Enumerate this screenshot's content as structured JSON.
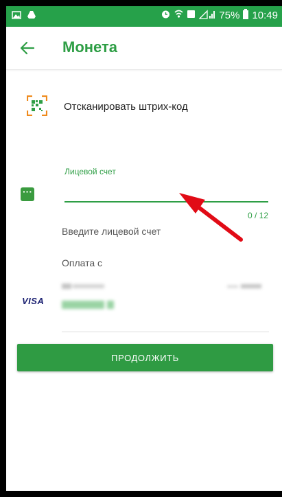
{
  "colors": {
    "accent": "#2e9e45",
    "status_bar": "#26a14a",
    "annotation_arrow": "#e10b16"
  },
  "status_bar": {
    "battery": "75%",
    "time": "10:49"
  },
  "toolbar": {
    "title": "Монета"
  },
  "scan": {
    "label": "Отсканировать штрих-код"
  },
  "account_field": {
    "label": "Лицевой счет",
    "value": "",
    "counter": "0 / 12",
    "helper": "Введите лицевой счет"
  },
  "payment": {
    "label": "Оплата с",
    "card_brand": "VISA"
  },
  "continue_button": {
    "label": "ПРОДОЛЖИТЬ"
  }
}
